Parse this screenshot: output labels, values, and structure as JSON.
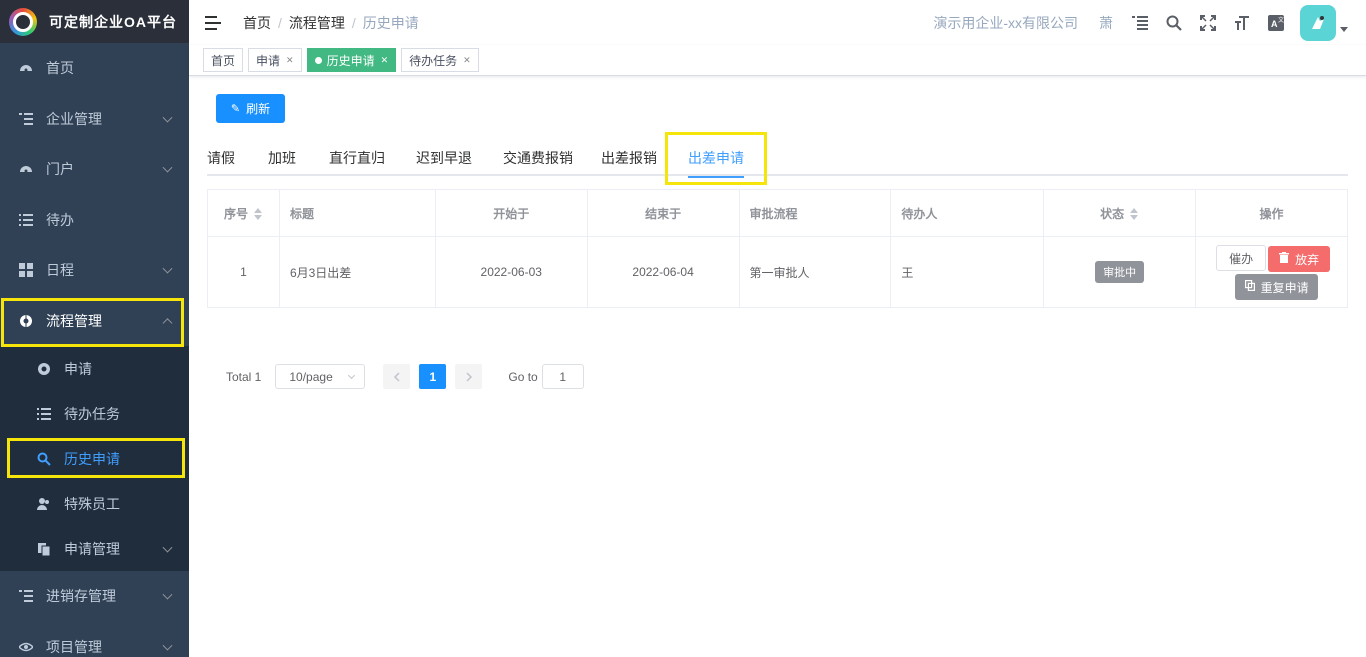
{
  "app": {
    "title": "可定制企业OA平台"
  },
  "sidebar": {
    "items": [
      {
        "label": "首页",
        "icon": "dashboard-icon"
      },
      {
        "label": "企业管理",
        "icon": "list-tree-icon"
      },
      {
        "label": "门户",
        "icon": "dashboard-icon"
      },
      {
        "label": "待办",
        "icon": "list-icon"
      },
      {
        "label": "日程",
        "icon": "grid-icon"
      },
      {
        "label": "流程管理",
        "icon": "gear-icon"
      }
    ],
    "submenu": [
      {
        "label": "申请",
        "icon": "gear-icon"
      },
      {
        "label": "待办任务",
        "icon": "list-icon"
      },
      {
        "label": "历史申请",
        "icon": "search-icon"
      },
      {
        "label": "特殊员工",
        "icon": "users-icon"
      },
      {
        "label": "申请管理",
        "icon": "copy-icon"
      }
    ],
    "bottom_items": [
      {
        "label": "进销存管理",
        "icon": "list-tree-icon"
      },
      {
        "label": "项目管理",
        "icon": "eye-icon"
      }
    ]
  },
  "navbar": {
    "breadcrumb": [
      "首页",
      "流程管理",
      "历史申请"
    ],
    "company": "演示用企业-xx有限公司",
    "user_char": "萧"
  },
  "tags": [
    {
      "label": "首页"
    },
    {
      "label": "申请"
    },
    {
      "label": "历史申请"
    },
    {
      "label": "待办任务"
    }
  ],
  "toolbar": {
    "refresh_label": "刷新"
  },
  "tabs": [
    "请假",
    "加班",
    "直行直归",
    "迟到早退",
    "交通费报销",
    "出差报销",
    "出差申请"
  ],
  "table": {
    "headers": [
      "序号",
      "标题",
      "开始于",
      "结束于",
      "审批流程",
      "待办人",
      "状态",
      "操作"
    ],
    "rows": [
      {
        "index": "1",
        "title": "6月3日出差",
        "start": "2022-06-03",
        "end": "2022-06-04",
        "flow": "第一审批人",
        "assignee": "王",
        "status": "审批中",
        "actions": [
          "催办",
          "放弃",
          "重复申请"
        ]
      }
    ]
  },
  "pagination": {
    "total_label": "Total 1",
    "page_size": "10/page",
    "current_page": "1",
    "goto_label": "Go to",
    "goto_value": "1"
  },
  "colors": {
    "sidebar_bg": "#304156",
    "accent": "#409eff",
    "primary_button": "#1890ff",
    "active_tag": "#42b983",
    "danger": "#f56c6c",
    "highlight": "#f5e50a"
  }
}
